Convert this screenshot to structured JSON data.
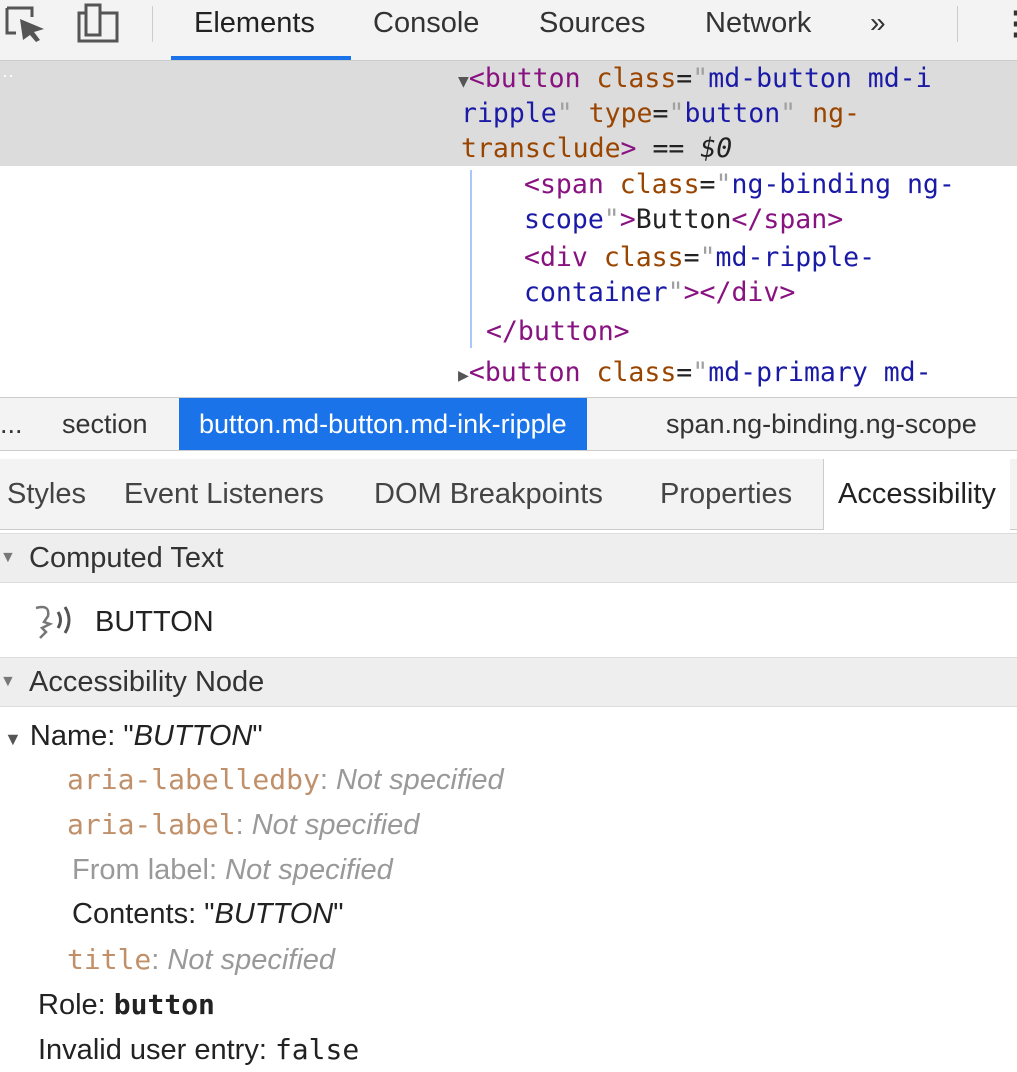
{
  "toolbar": {
    "tabs": [
      "Elements",
      "Console",
      "Sources",
      "Network"
    ],
    "overflow_glyph": "»",
    "menu_glyph": "⋮"
  },
  "dom": {
    "line1": {
      "open": "<",
      "tag": "button",
      "attr1": "class",
      "eq": "=",
      "q": "\"",
      "val1": "md-button md-i"
    },
    "line2": {
      "val1b": "ripple",
      "q": "\"",
      "attr2": "type",
      "eq": "=",
      "val2": "button",
      "attr3": "ng-"
    },
    "line3": {
      "attr3b": "transclude",
      "close": ">",
      "marker": " == ",
      "dollar": "$0"
    },
    "line4": {
      "open": "<",
      "tag": "span",
      "attr": "class",
      "eq": "=",
      "q": "\"",
      "val": "ng-binding ng-"
    },
    "line5": {
      "val": "scope",
      "q": "\"",
      "close": ">",
      "text": "Button",
      "end_open": "</",
      "end_tag": "span",
      "end_close": ">"
    },
    "line6": {
      "open": "<",
      "tag": "div",
      "attr": "class",
      "eq": "=",
      "q": "\"",
      "val": "md-ripple-"
    },
    "line7": {
      "val": "container",
      "q": "\"",
      "close": ">",
      "end_open": "</",
      "end_tag": "div",
      "end_close": ">"
    },
    "line8": {
      "end_open": "</",
      "end_tag": "button",
      "end_close": ">"
    },
    "line9": {
      "open": "<",
      "tag": "button",
      "attr": "class",
      "eq": "=",
      "q": "\"",
      "val": "md-primary md-"
    }
  },
  "breadcrumbs": {
    "ellipsis": "...",
    "items": [
      "section",
      "button.md-button.md-ink-ripple",
      "span.ng-binding.ng-scope"
    ]
  },
  "subtabs": [
    "Styles",
    "Event Listeners",
    "DOM Breakpoints",
    "Properties",
    "Accessibility"
  ],
  "accessibility": {
    "computed_text_header": "Computed Text",
    "computed_text_value": "BUTTON",
    "node_header": "Accessibility Node",
    "name_label": "Name: ",
    "name_quote": "\"",
    "name_value": "BUTTON",
    "aria_labelledby": {
      "name": "aria-labelledby",
      "sep": ": ",
      "value": "Not specified"
    },
    "aria_label": {
      "name": "aria-label",
      "sep": ": ",
      "value": "Not specified"
    },
    "from_label": {
      "name": "From label",
      "sep": ": ",
      "value": "Not specified"
    },
    "contents": {
      "name": "Contents",
      "sep": ": ",
      "quote": "\"",
      "value": "BUTTON"
    },
    "title": {
      "name": "title",
      "sep": ": ",
      "value": "Not specified"
    },
    "role": {
      "name": "Role: ",
      "value": "button"
    },
    "invalid": {
      "name": "Invalid user entry: ",
      "value": "false"
    }
  },
  "colors": {
    "accent": "#1a73e8",
    "tag": "#881280",
    "attribute": "#994500",
    "attribute_value": "#1a1aa6",
    "aria_attribute": "#c0906a"
  }
}
